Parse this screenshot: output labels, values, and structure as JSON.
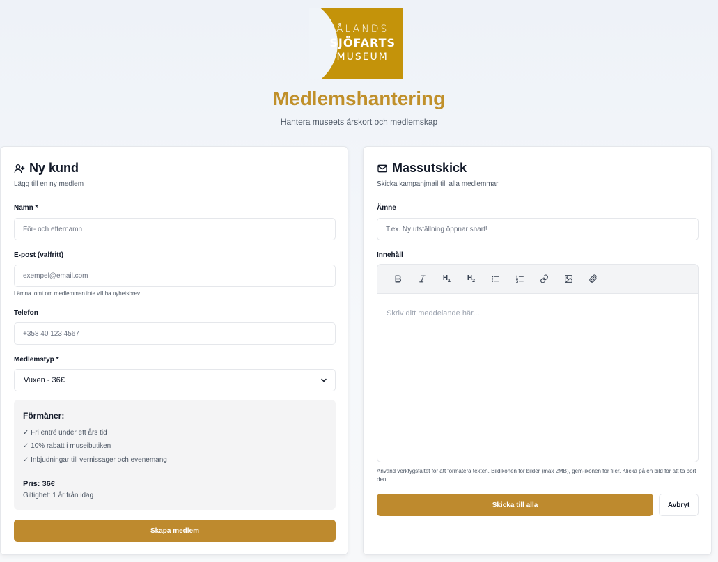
{
  "logo": {
    "line1": "ÅLANDS",
    "line2": "SJÖFARTS",
    "line3": "MUSEUM"
  },
  "header": {
    "title": "Medlemshantering",
    "subtitle": "Hantera museets årskort och medlemskap"
  },
  "new_customer": {
    "title": "Ny kund",
    "subtitle": "Lägg till en ny medlem",
    "name_label": "Namn *",
    "name_placeholder": "För- och efternamn",
    "email_label": "E-post (valfritt)",
    "email_placeholder": "exempel@email.com",
    "email_hint": "Lämna tomt om medlemmen inte vill ha nyhetsbrev",
    "phone_label": "Telefon",
    "phone_placeholder": "+358 40 123 4567",
    "type_label": "Medlemstyp *",
    "type_selected": "Vuxen - 36€",
    "benefits": {
      "title": "Förmåner:",
      "items": [
        "✓ Fri entré under ett års tid",
        "✓ 10% rabatt i museibutiken",
        "✓ Inbjudningar till vernissager och evenemang"
      ],
      "price": "Pris: 36€",
      "validity": "Giltighet: 1 år från idag"
    },
    "create_button": "Skapa medlem"
  },
  "mass_mail": {
    "title": "Massutskick",
    "subtitle": "Skicka kampanjmail till alla medlemmar",
    "subject_label": "Ämne",
    "subject_placeholder": "T.ex. Ny utställning öppnar snart!",
    "content_label": "Innehåll",
    "toolbar": {
      "bold": "B",
      "italic": "I",
      "h1": "H",
      "h1_sub": "1",
      "h2": "H",
      "h2_sub": "2"
    },
    "editor_placeholder": "Skriv ditt meddelande här...",
    "editor_hint": "Använd verktygsfältet för att formatera texten. Bildikonen för bilder (max 2MB), gem-ikonen för filer. Klicka på en bild för att ta bort den.",
    "send_button": "Skicka till alla",
    "cancel_button": "Avbryt"
  },
  "colors": {
    "brand_gold": "#c4930a",
    "title_gold": "#c0902b",
    "button_gold": "#be8a2e"
  }
}
